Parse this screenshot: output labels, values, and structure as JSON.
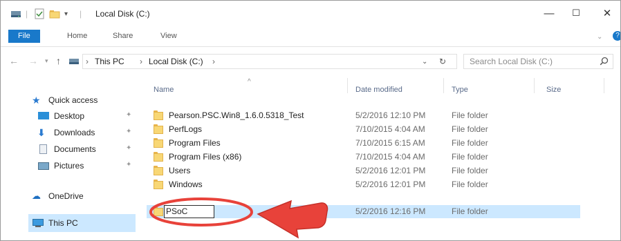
{
  "window": {
    "title": "Local Disk (C:)",
    "controls": {
      "minimize": "—",
      "maximize": "☐",
      "close": "✕"
    }
  },
  "ribbon": {
    "tabs": [
      "File",
      "Home",
      "Share",
      "View"
    ]
  },
  "address": {
    "segments": [
      "This PC",
      "Local Disk (C:)"
    ],
    "separator": "›",
    "search_placeholder": "Search Local Disk (C:)"
  },
  "nav_pane": {
    "items": [
      {
        "label": "Quick access",
        "icon": "star-icon"
      },
      {
        "label": "Desktop",
        "icon": "desktop-folder-icon",
        "pinned": true
      },
      {
        "label": "Downloads",
        "icon": "download-arrow-icon",
        "pinned": true
      },
      {
        "label": "Documents",
        "icon": "documents-icon",
        "pinned": true
      },
      {
        "label": "Pictures",
        "icon": "pictures-icon",
        "pinned": true
      },
      {
        "label": "OneDrive",
        "icon": "cloud-icon"
      },
      {
        "label": "This PC",
        "icon": "computer-icon",
        "selected": true
      }
    ]
  },
  "file_list": {
    "columns": [
      "Name",
      "Date modified",
      "Type",
      "Size"
    ],
    "rows": [
      {
        "name": "Pearson.PSC.Win8_1.6.0.5318_Test",
        "date": "5/2/2016 12:10 PM",
        "type": "File folder"
      },
      {
        "name": "PerfLogs",
        "date": "7/10/2015 4:04 AM",
        "type": "File folder"
      },
      {
        "name": "Program Files",
        "date": "7/10/2015 6:15 AM",
        "type": "File folder"
      },
      {
        "name": "Program Files (x86)",
        "date": "7/10/2015 4:04 AM",
        "type": "File folder"
      },
      {
        "name": "Users",
        "date": "5/2/2016 12:01 PM",
        "type": "File folder"
      },
      {
        "name": "Windows",
        "date": "5/2/2016 12:01 PM",
        "type": "File folder"
      },
      {
        "name": "PSoC",
        "date": "5/2/2016 12:16 PM",
        "type": "File folder",
        "selected": true,
        "renaming": true
      }
    ]
  },
  "annotation": {
    "color": "#e8423a"
  }
}
